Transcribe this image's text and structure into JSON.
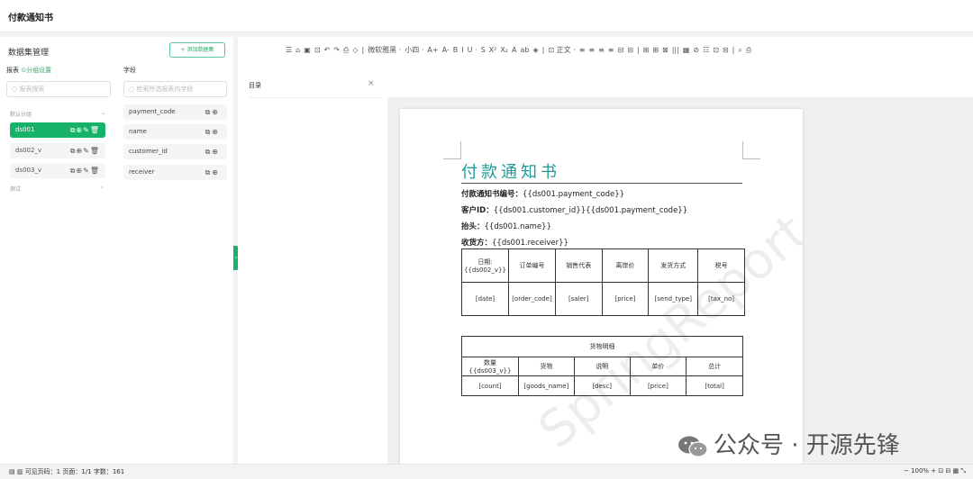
{
  "app": {
    "title": "付款通知书"
  },
  "left_panel": {
    "header": "数据集管理",
    "add_button": "+ 添加数据集",
    "reports_label": "报表",
    "group_settings": "⊙分组设置",
    "fields_label": "字段",
    "report_search_placeholder": "○ 报表搜索",
    "field_search_placeholder": "○ 检索所选报表内字段",
    "default_group": "默认分组",
    "test_group": "测试",
    "datasets": [
      {
        "name": "ds001",
        "active": true
      },
      {
        "name": "ds002_v",
        "active": false
      },
      {
        "name": "ds003_v",
        "active": false
      }
    ],
    "dataset_ops": "⧉⊕✎🗑",
    "fields": [
      {
        "name": "payment_code"
      },
      {
        "name": "name"
      },
      {
        "name": "customer_id"
      },
      {
        "name": "receiver"
      }
    ],
    "field_ops": "⧉⊕"
  },
  "toolbar": {
    "font_name": "微软雅黑",
    "font_size": "小四",
    "items": [
      "☰",
      "⌂",
      "▣",
      "⊡",
      "↶",
      "↷",
      "⎙",
      "◇",
      "|",
      "微软雅黑 ·",
      "小四 ·",
      "A+",
      "A-",
      "B",
      "I",
      "U ·",
      "S",
      "X²",
      "X₂",
      "A",
      "ab",
      "◈",
      "|",
      "⊡ 正文 ·",
      "≡",
      "≡",
      "≡",
      "≡",
      "⊟",
      "⊟",
      "|",
      "⊞",
      "⊞",
      "⊠",
      "|||",
      "▦",
      "⊘",
      "☷",
      "⊡",
      "⊟",
      "|",
      "⌕",
      "⎙"
    ]
  },
  "outline": {
    "label": "目录",
    "close": "×"
  },
  "document": {
    "title": "付款通知书",
    "lines": [
      {
        "label": "付款通知书编号：",
        "value": "{{ds001.payment_code}}"
      },
      {
        "label": "客户ID：",
        "value": "{{ds001.customer_id}}{{ds001.payment_code}}"
      },
      {
        "label": "抬头：",
        "value": "{{ds001.name}}"
      },
      {
        "label": "收货方：",
        "value": "{{ds001.receiver}}"
      }
    ],
    "table1": {
      "headers": [
        "日期:{{ds002_v}}",
        "订单编号",
        "销售代表",
        "离岸价",
        "发货方式",
        "税号"
      ],
      "row": [
        "[date]",
        "[order_code]",
        "[saler]",
        "[price]",
        "[send_type]",
        "[tax_no]"
      ]
    },
    "table2": {
      "caption": "货物明细",
      "headers": [
        "数量{{ds003_v}}",
        "货物",
        "说明",
        "单价",
        "总计"
      ],
      "row": [
        "[count]",
        "[goods_name]",
        "[desc]",
        "[price]",
        "[total]"
      ]
    },
    "watermark": "SpringReport"
  },
  "overlay": {
    "wechat": "公众号 · 开源先锋"
  },
  "status": {
    "left": "可见页码：1 页面：1/1 字数：161",
    "zoom": "100%"
  },
  "colors": {
    "accent": "#17b26a",
    "title": "#1e9a9a"
  }
}
